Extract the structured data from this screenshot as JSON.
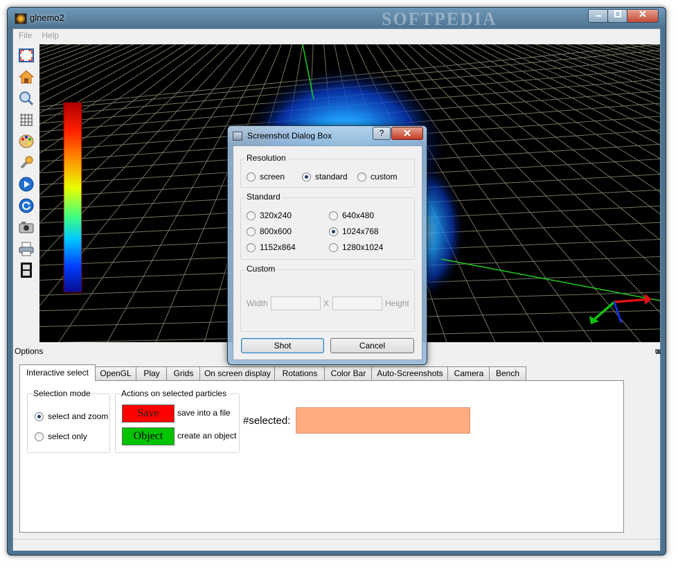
{
  "window": {
    "title": "glnemo2",
    "watermark": "SOFTPEDIA"
  },
  "menu": {
    "items": [
      "File",
      "Help"
    ]
  },
  "toolbar": {
    "icons": [
      "fullscreen-icon",
      "home-icon",
      "zoom-icon",
      "grid-icon",
      "palette-icon",
      "wrench-icon",
      "play-icon",
      "rotate-icon",
      "camera-icon",
      "printer-icon",
      "film-icon"
    ]
  },
  "options": {
    "title": "Options",
    "tabs": [
      "Interactive select",
      "OpenGL",
      "Play",
      "Grids",
      "On screen display",
      "Rotations",
      "Color Bar",
      "Auto-Screenshots",
      "Camera",
      "Bench"
    ],
    "active_tab": "Interactive select",
    "selection_mode": {
      "title": "Selection mode",
      "options": [
        "select and zoom",
        "select only"
      ],
      "selected": "select and zoom"
    },
    "actions": {
      "title": "Actions on selected particles",
      "save_label": "Save",
      "save_desc": "save into a file",
      "object_label": "Object",
      "object_desc": "create an object"
    },
    "selected_label": "#selected:",
    "selected_box_color": "#ffac80"
  },
  "dialog": {
    "title": "Screenshot Dialog Box",
    "help": "?",
    "resolution": {
      "title": "Resolution",
      "options": [
        "screen",
        "standard",
        "custom"
      ],
      "selected": "standard"
    },
    "standard": {
      "title": "Standard",
      "options": [
        "320x240",
        "640x480",
        "800x600",
        "1024x768",
        "1152x864",
        "1280x1024"
      ],
      "selected": "1024x768"
    },
    "custom": {
      "title": "Custom",
      "width_label": "Width",
      "x_label": "X",
      "height_label": "Height"
    },
    "shot_label": "Shot",
    "cancel_label": "Cancel"
  },
  "colors": {
    "accent": "#3c7fb1",
    "save_red": "#ff0000",
    "object_green": "#00c400"
  }
}
